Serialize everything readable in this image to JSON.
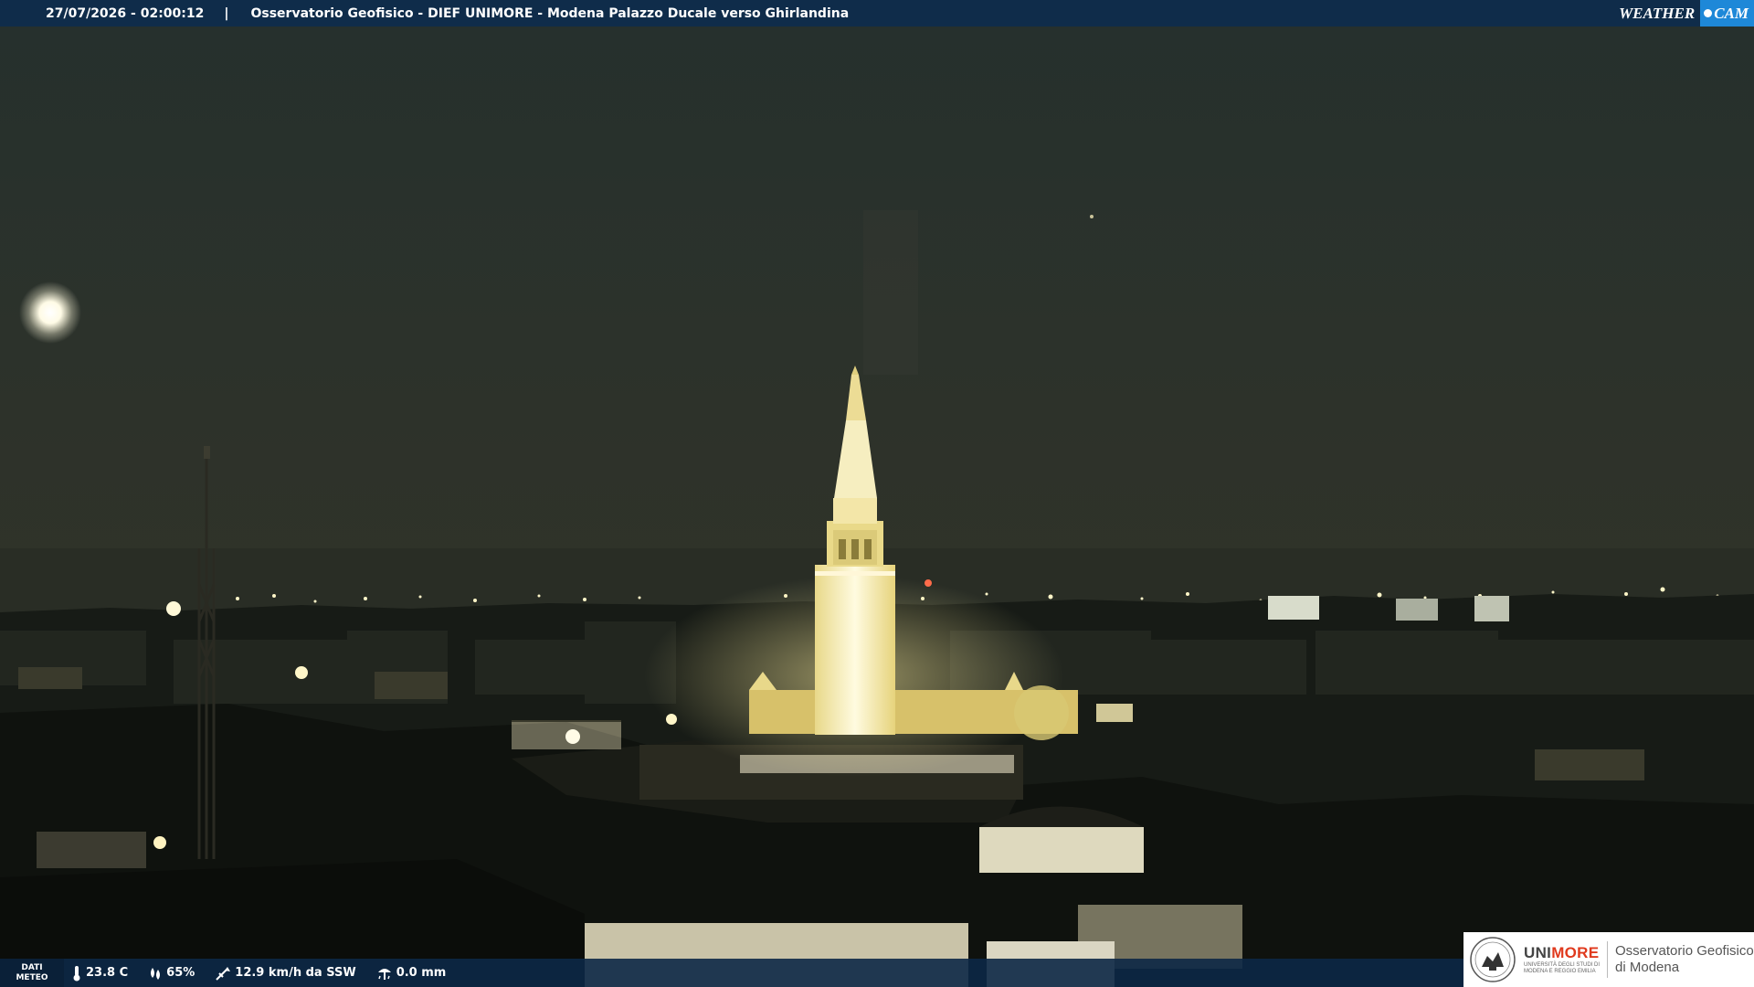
{
  "top_bar": {
    "timestamp": "27/07/2026 - 02:00:12",
    "separator": "|",
    "title": "Osservatorio Geofisico - DIEF UNIMORE - Modena Palazzo Ducale verso Ghirlandina"
  },
  "brand_logo": {
    "part1": "WEATHER",
    "part2": "CAM",
    "icon": "webcam-dot-icon"
  },
  "weather": {
    "label_line1": "DATI",
    "label_line2": "METEO",
    "temperature": "23.8 C",
    "humidity": "65%",
    "wind": "12.9 km/h da SSW",
    "rain": "0.0 mm",
    "icons": [
      "thermometer-icon",
      "humidity-drop-icon",
      "wind-vane-icon",
      "rain-gauge-icon"
    ]
  },
  "institution": {
    "brand_a": "UNI",
    "brand_b": "MORE",
    "subtitle_line1": "UNIVERSITÀ DEGLI STUDI DI",
    "subtitle_line2": "MODENA E REGGIO EMILIA",
    "obs_line1": "Osservatorio Geofisico",
    "obs_line2": "di Modena",
    "seal_icon": "university-seal-icon"
  },
  "colors": {
    "sky": "#2a302b",
    "tower_light": "#f3e6a8",
    "bar_blue": "#0f2c4a",
    "brand_red": "#e03a1e",
    "cam_blue": "#1e88d8"
  }
}
